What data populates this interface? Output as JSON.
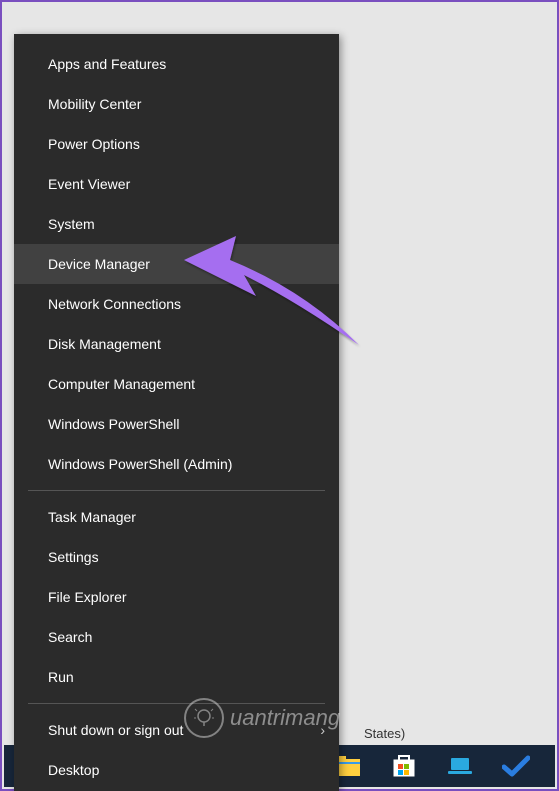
{
  "menu": {
    "items": [
      {
        "label": "Apps and Features",
        "hover": false,
        "submenu": false
      },
      {
        "label": "Mobility Center",
        "hover": false,
        "submenu": false
      },
      {
        "label": "Power Options",
        "hover": false,
        "submenu": false
      },
      {
        "label": "Event Viewer",
        "hover": false,
        "submenu": false
      },
      {
        "label": "System",
        "hover": false,
        "submenu": false
      },
      {
        "label": "Device Manager",
        "hover": true,
        "submenu": false
      },
      {
        "label": "Network Connections",
        "hover": false,
        "submenu": false
      },
      {
        "label": "Disk Management",
        "hover": false,
        "submenu": false
      },
      {
        "label": "Computer Management",
        "hover": false,
        "submenu": false
      },
      {
        "label": "Windows PowerShell",
        "hover": false,
        "submenu": false
      },
      {
        "label": "Windows PowerShell (Admin)",
        "hover": false,
        "submenu": false
      }
    ],
    "group2": [
      {
        "label": "Task Manager",
        "hover": false,
        "submenu": false
      },
      {
        "label": "Settings",
        "hover": false,
        "submenu": false
      },
      {
        "label": "File Explorer",
        "hover": false,
        "submenu": false
      },
      {
        "label": "Search",
        "hover": false,
        "submenu": false
      },
      {
        "label": "Run",
        "hover": false,
        "submenu": false
      }
    ],
    "group3": [
      {
        "label": "Shut down or sign out",
        "hover": false,
        "submenu": true
      },
      {
        "label": "Desktop",
        "hover": false,
        "submenu": false
      }
    ]
  },
  "systray_partial": "States)",
  "watermark_text": "uantrimang",
  "annotation": {
    "color": "#a56ef0"
  }
}
